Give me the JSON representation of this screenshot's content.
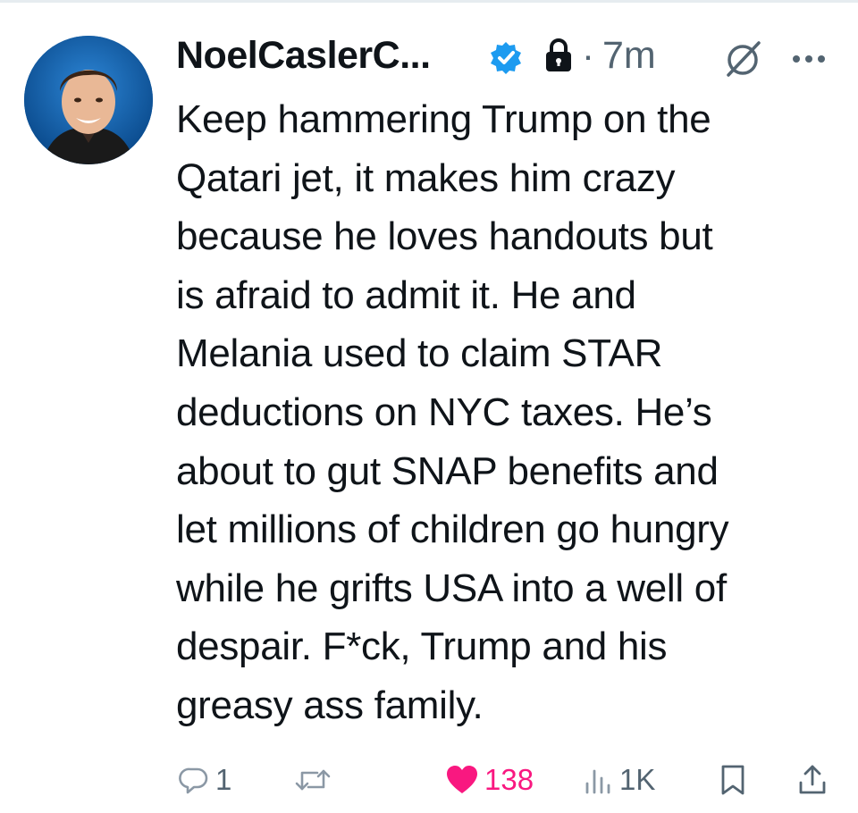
{
  "tweet": {
    "author_name": "NoelCaslerC...",
    "separator": "·",
    "time": "7m",
    "text": "Keep hammering Trump on the\nQatari jet, it makes him crazy\nbecause he loves handouts but\nis afraid to admit it. He and\nMelania used to claim STAR\ndeductions on NYC taxes. He’s\nabout to gut SNAP benefits and\nlet millions of children go hungry\nwhile he grifts USA into a well of\ndespair. F*ck, Trump and his\ngreasy ass family."
  },
  "actions": {
    "reply_count": "1",
    "retweet_count": "",
    "like_count": "138",
    "views_count": "1K"
  },
  "icons": {
    "verified": "verified-badge-icon",
    "lock": "lock-icon",
    "grok": "grok-icon",
    "more": "more-icon",
    "reply": "reply-icon",
    "retweet": "retweet-icon",
    "like": "heart-icon",
    "views": "views-icon",
    "bookmark": "bookmark-icon",
    "share": "share-icon"
  },
  "colors": {
    "text": "#0f1419",
    "muted": "#536471",
    "verified": "#1d9bf0",
    "like": "#f91880",
    "muted_icon": "#8b98a5"
  }
}
